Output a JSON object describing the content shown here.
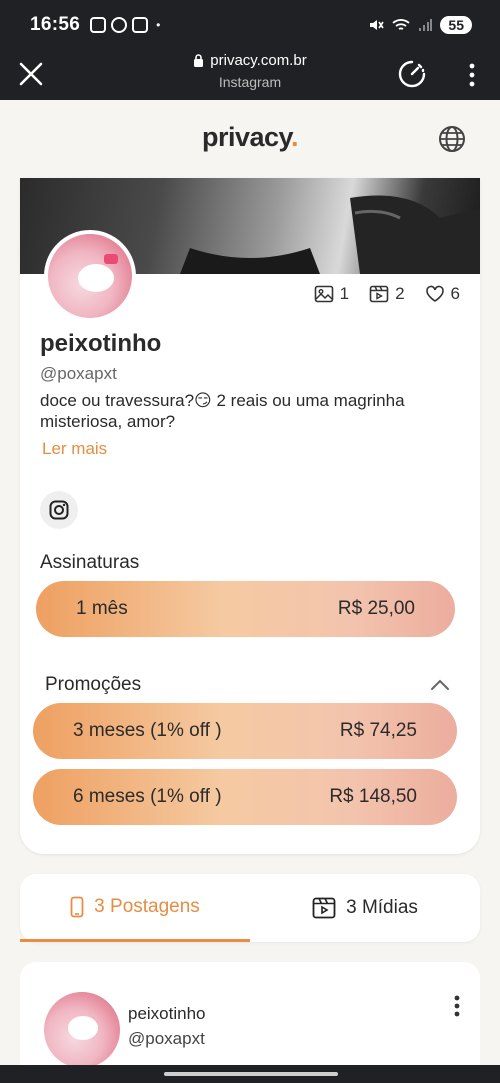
{
  "status_bar": {
    "time": "16:56",
    "dot": "•",
    "battery": "55"
  },
  "browser": {
    "url": "privacy.com.br",
    "subtitle": "Instagram"
  },
  "site": {
    "logo_main": "privacy",
    "logo_accent": "."
  },
  "profile": {
    "stats": {
      "images": "1",
      "videos": "2",
      "likes": "6"
    },
    "name": "peixotinho",
    "handle": "@poxapxt",
    "bio": "doce ou travessura?😏 2 reais ou uma magrinha misteriosa, amor?",
    "read_more": "Ler mais"
  },
  "subscriptions": {
    "title": "Assinaturas",
    "plan": {
      "label": "1 mês",
      "price": "R$ 25,00"
    }
  },
  "promotions": {
    "title": "Promoções",
    "items": [
      {
        "label": "3 meses (1% off )",
        "price": "R$ 74,25"
      },
      {
        "label": "6 meses (1% off )",
        "price": "R$ 148,50"
      }
    ]
  },
  "tabs": {
    "posts": "3 Postagens",
    "media": "3 Mídias"
  },
  "post": {
    "name": "peixotinho",
    "handle": "@poxapxt"
  },
  "colors": {
    "accent": "#e88c42",
    "chrome": "#202124"
  }
}
